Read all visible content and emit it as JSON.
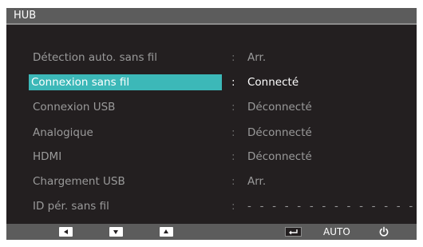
{
  "header": {
    "title": "HUB"
  },
  "menu": {
    "items": [
      {
        "label": "Détection auto. sans fil",
        "separator": ":",
        "value": "Arr.",
        "selected": false
      },
      {
        "label": "Connexion sans fil",
        "separator": ":",
        "value": "Connecté",
        "selected": true
      },
      {
        "label": "Connexion USB",
        "separator": ":",
        "value": "Déconnecté",
        "selected": false
      },
      {
        "label": "Analogique",
        "separator": ":",
        "value": "Déconnecté",
        "selected": false
      },
      {
        "label": "HDMI",
        "separator": ":",
        "value": "Déconnecté",
        "selected": false
      },
      {
        "label": "Chargement USB",
        "separator": ":",
        "value": "Arr.",
        "selected": false
      },
      {
        "label": "ID pér. sans fil",
        "separator": ":",
        "value": "- - - - - - - - - - - - - - - -",
        "selected": false
      }
    ]
  },
  "footer": {
    "buttons": [
      {
        "icon": "left-arrow-icon"
      },
      {
        "icon": "down-arrow-icon"
      },
      {
        "icon": "up-arrow-icon"
      },
      {
        "icon": "enter-icon"
      },
      {
        "icon": "auto-label",
        "label": "AUTO"
      },
      {
        "icon": "power-icon"
      }
    ]
  },
  "colors": {
    "background": "#231f20",
    "bar": "#5c5c5c",
    "highlight": "#3cb8b8",
    "text_dim": "#9a9a9a",
    "text_bright": "#ffffff"
  }
}
